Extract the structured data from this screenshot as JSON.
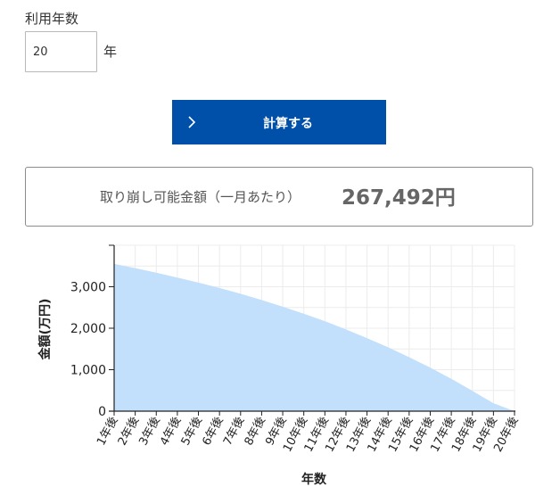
{
  "form": {
    "years_label": "利用年数",
    "years_value": "20",
    "years_unit": "年",
    "calculate_button": "計算する"
  },
  "result": {
    "label": "取り崩し可能金額（一月あたり）",
    "value": "267,492円"
  },
  "chart_data": {
    "type": "area",
    "title": "",
    "xlabel": "年数",
    "ylabel": "金額(万円)",
    "ylim": [
      0,
      4000
    ],
    "yticks": [
      0,
      1000,
      2000,
      3000
    ],
    "ytick_labels": [
      "0",
      "1,000",
      "2,000",
      "3,000"
    ],
    "grid": true,
    "categories": [
      "1年後",
      "2年後",
      "3年後",
      "4年後",
      "5年後",
      "6年後",
      "7年後",
      "8年後",
      "9年後",
      "10年後",
      "11年後",
      "12年後",
      "13年後",
      "14年後",
      "15年後",
      "16年後",
      "17年後",
      "18年後",
      "19年後",
      "20年後"
    ],
    "values": [
      3550,
      3450,
      3340,
      3220,
      3100,
      2970,
      2830,
      2680,
      2520,
      2350,
      2170,
      1970,
      1760,
      1540,
      1300,
      1050,
      780,
      490,
      190,
      0
    ],
    "fill_color": "#c2dffc"
  }
}
